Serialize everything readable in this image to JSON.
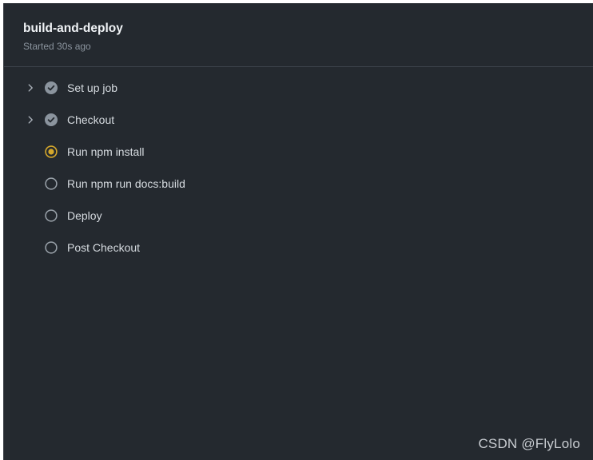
{
  "job": {
    "title": "build-and-deploy",
    "subtitle": "Started 30s ago"
  },
  "steps": [
    {
      "label": "Set up job",
      "status": "completed",
      "expandable": true
    },
    {
      "label": "Checkout",
      "status": "completed",
      "expandable": true
    },
    {
      "label": "Run npm install",
      "status": "in_progress",
      "expandable": false
    },
    {
      "label": "Run npm run docs:build",
      "status": "queued",
      "expandable": false
    },
    {
      "label": "Deploy",
      "status": "queued",
      "expandable": false
    },
    {
      "label": "Post Checkout",
      "status": "queued",
      "expandable": false
    }
  ],
  "icons": {
    "expand": "chevron-right-icon",
    "completed": "check-circle-icon",
    "in_progress": "in-progress-circle-icon",
    "queued": "empty-circle-icon"
  },
  "colors": {
    "background": "#24292f",
    "completed": "#8b949e",
    "in_progress": "#d4a72c",
    "queued": "#8b949e",
    "text": "#d6dbe0"
  },
  "watermark": "CSDN @FlyLolo"
}
